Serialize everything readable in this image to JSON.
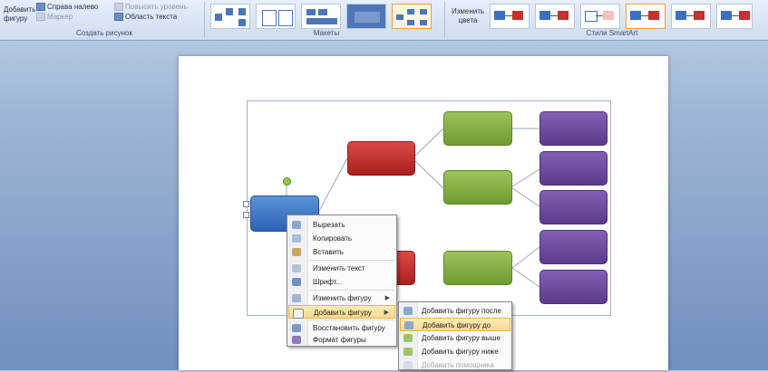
{
  "ribbon": {
    "create_group_label": "Создать рисунок",
    "layouts_group_label": "Макеты",
    "styles_group_label": "Стили SmartArt",
    "add_shape_label": "Добавить фигуру",
    "add_bullet_label": "Маркер",
    "text_pane_label": "Область текста",
    "right_to_left_label": "Справа налево",
    "promote_label": "Повысить уровень",
    "change_colors_label": "Изменить цвета"
  },
  "context_menu": {
    "items": [
      {
        "label": "Вырезать",
        "icon": "cut-icon"
      },
      {
        "label": "Копировать",
        "icon": "copy-icon"
      },
      {
        "label": "Вставить",
        "icon": "paste-icon"
      },
      {
        "label": "Изменить текст",
        "icon": "edit-text-icon"
      },
      {
        "label": "Шрифт...",
        "icon": "font-icon"
      },
      {
        "label": "Изменить фигуру",
        "icon": "change-shape-icon"
      },
      {
        "label": "Добавить фигуру",
        "icon": "add-shape-icon"
      },
      {
        "label": "Восстановить фигуру",
        "icon": "reset-shape-icon"
      },
      {
        "label": "Формат фигуры",
        "icon": "format-shape-icon"
      }
    ]
  },
  "submenu": {
    "items": [
      {
        "label": "Добавить фигуру после",
        "icon": "add-after-icon"
      },
      {
        "label": "Добавить фигуру до",
        "icon": "add-before-icon"
      },
      {
        "label": "Добавить фигуру выше",
        "icon": "add-above-icon"
      },
      {
        "label": "Добавить фигуру ниже",
        "icon": "add-below-icon"
      },
      {
        "label": "Добавить помощника",
        "icon": "add-assistant-icon"
      }
    ]
  },
  "colors": {
    "blue": "#2e62b4",
    "red": "#c6302e",
    "green": "#8ab24a",
    "purple": "#6a49a0",
    "menu_highlight": "#fbd98b"
  }
}
